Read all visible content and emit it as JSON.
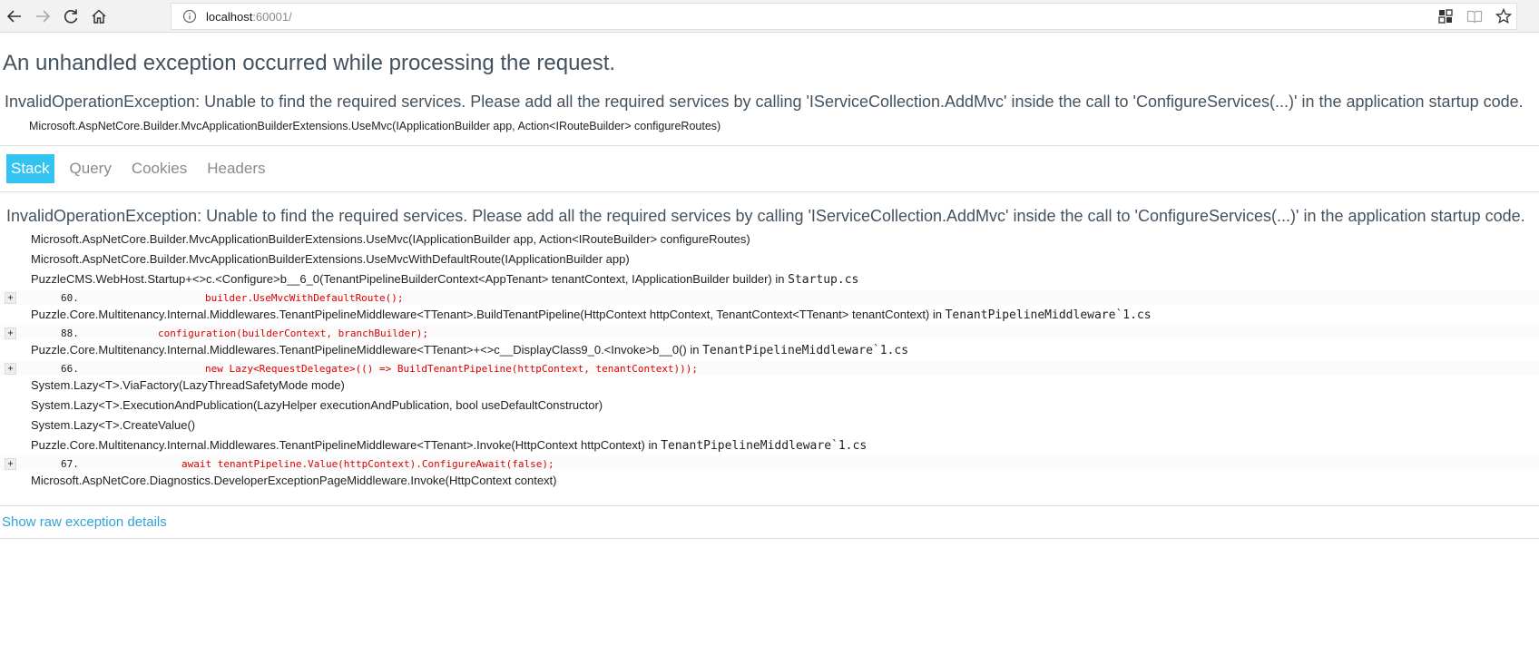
{
  "browser": {
    "url_host": "localhost",
    "url_port": ":60001/"
  },
  "page": {
    "title": "An unhandled exception occurred while processing the request.",
    "error_message": "InvalidOperationException: Unable to find the required services. Please add all the required services by calling 'IServiceCollection.AddMvc' inside the call to 'ConfigureServices(...)' in the application startup code.",
    "location": "Microsoft.AspNetCore.Builder.MvcApplicationBuilderExtensions.UseMvc(IApplicationBuilder app, Action<IRouteBuilder> configureRoutes)",
    "tabs": [
      "Stack",
      "Query",
      "Cookies",
      "Headers"
    ],
    "selected_tab": "Stack",
    "raw_link": "Show raw exception details"
  },
  "stack": {
    "error_message": "InvalidOperationException: Unable to find the required services. Please add all the required services by calling 'IServiceCollection.AddMvc' inside the call to 'ConfigureServices(...)' in the application startup code.",
    "frames": [
      {
        "method": "Microsoft.AspNetCore.Builder.MvcApplicationBuilderExtensions.UseMvc(IApplicationBuilder app, Action<IRouteBuilder> configureRoutes)"
      },
      {
        "method": "Microsoft.AspNetCore.Builder.MvcApplicationBuilderExtensions.UseMvcWithDefaultRoute(IApplicationBuilder app)"
      },
      {
        "method": "PuzzleCMS.WebHost.Startup+<>c.<Configure>b__6_0(TenantPipelineBuilderContext<AppTenant> tenantContext, IApplicationBuilder builder) in ",
        "file": "Startup.cs",
        "line": "60.",
        "code": "builder.UseMvcWithDefaultRoute();"
      },
      {
        "method": "Puzzle.Core.Multitenancy.Internal.Middlewares.TenantPipelineMiddleware<TTenant>.BuildTenantPipeline(HttpContext httpContext, TenantContext<TTenant> tenantContext) in ",
        "file": "TenantPipelineMiddleware`1.cs",
        "line": "88.",
        "code": "configuration(builderContext, branchBuilder);"
      },
      {
        "method": "Puzzle.Core.Multitenancy.Internal.Middlewares.TenantPipelineMiddleware<TTenant>+<>c__DisplayClass9_0.<Invoke>b__0() in ",
        "file": "TenantPipelineMiddleware`1.cs",
        "line": "66.",
        "code": "new Lazy<RequestDelegate>(() => BuildTenantPipeline(httpContext, tenantContext)));"
      },
      {
        "method": "System.Lazy<T>.ViaFactory(LazyThreadSafetyMode mode)"
      },
      {
        "method": "System.Lazy<T>.ExecutionAndPublication(LazyHelper executionAndPublication, bool useDefaultConstructor)"
      },
      {
        "method": "System.Lazy<T>.CreateValue()"
      },
      {
        "method": "Puzzle.Core.Multitenancy.Internal.Middlewares.TenantPipelineMiddleware<TTenant>.Invoke(HttpContext httpContext) in ",
        "file": "TenantPipelineMiddleware`1.cs",
        "line": "67.",
        "code": "await tenantPipeline.Value(httpContext).ConfigureAwait(false);"
      },
      {
        "method": "Microsoft.AspNetCore.Diagnostics.DeveloperExceptionPageMiddleware.Invoke(HttpContext context)"
      }
    ]
  }
}
